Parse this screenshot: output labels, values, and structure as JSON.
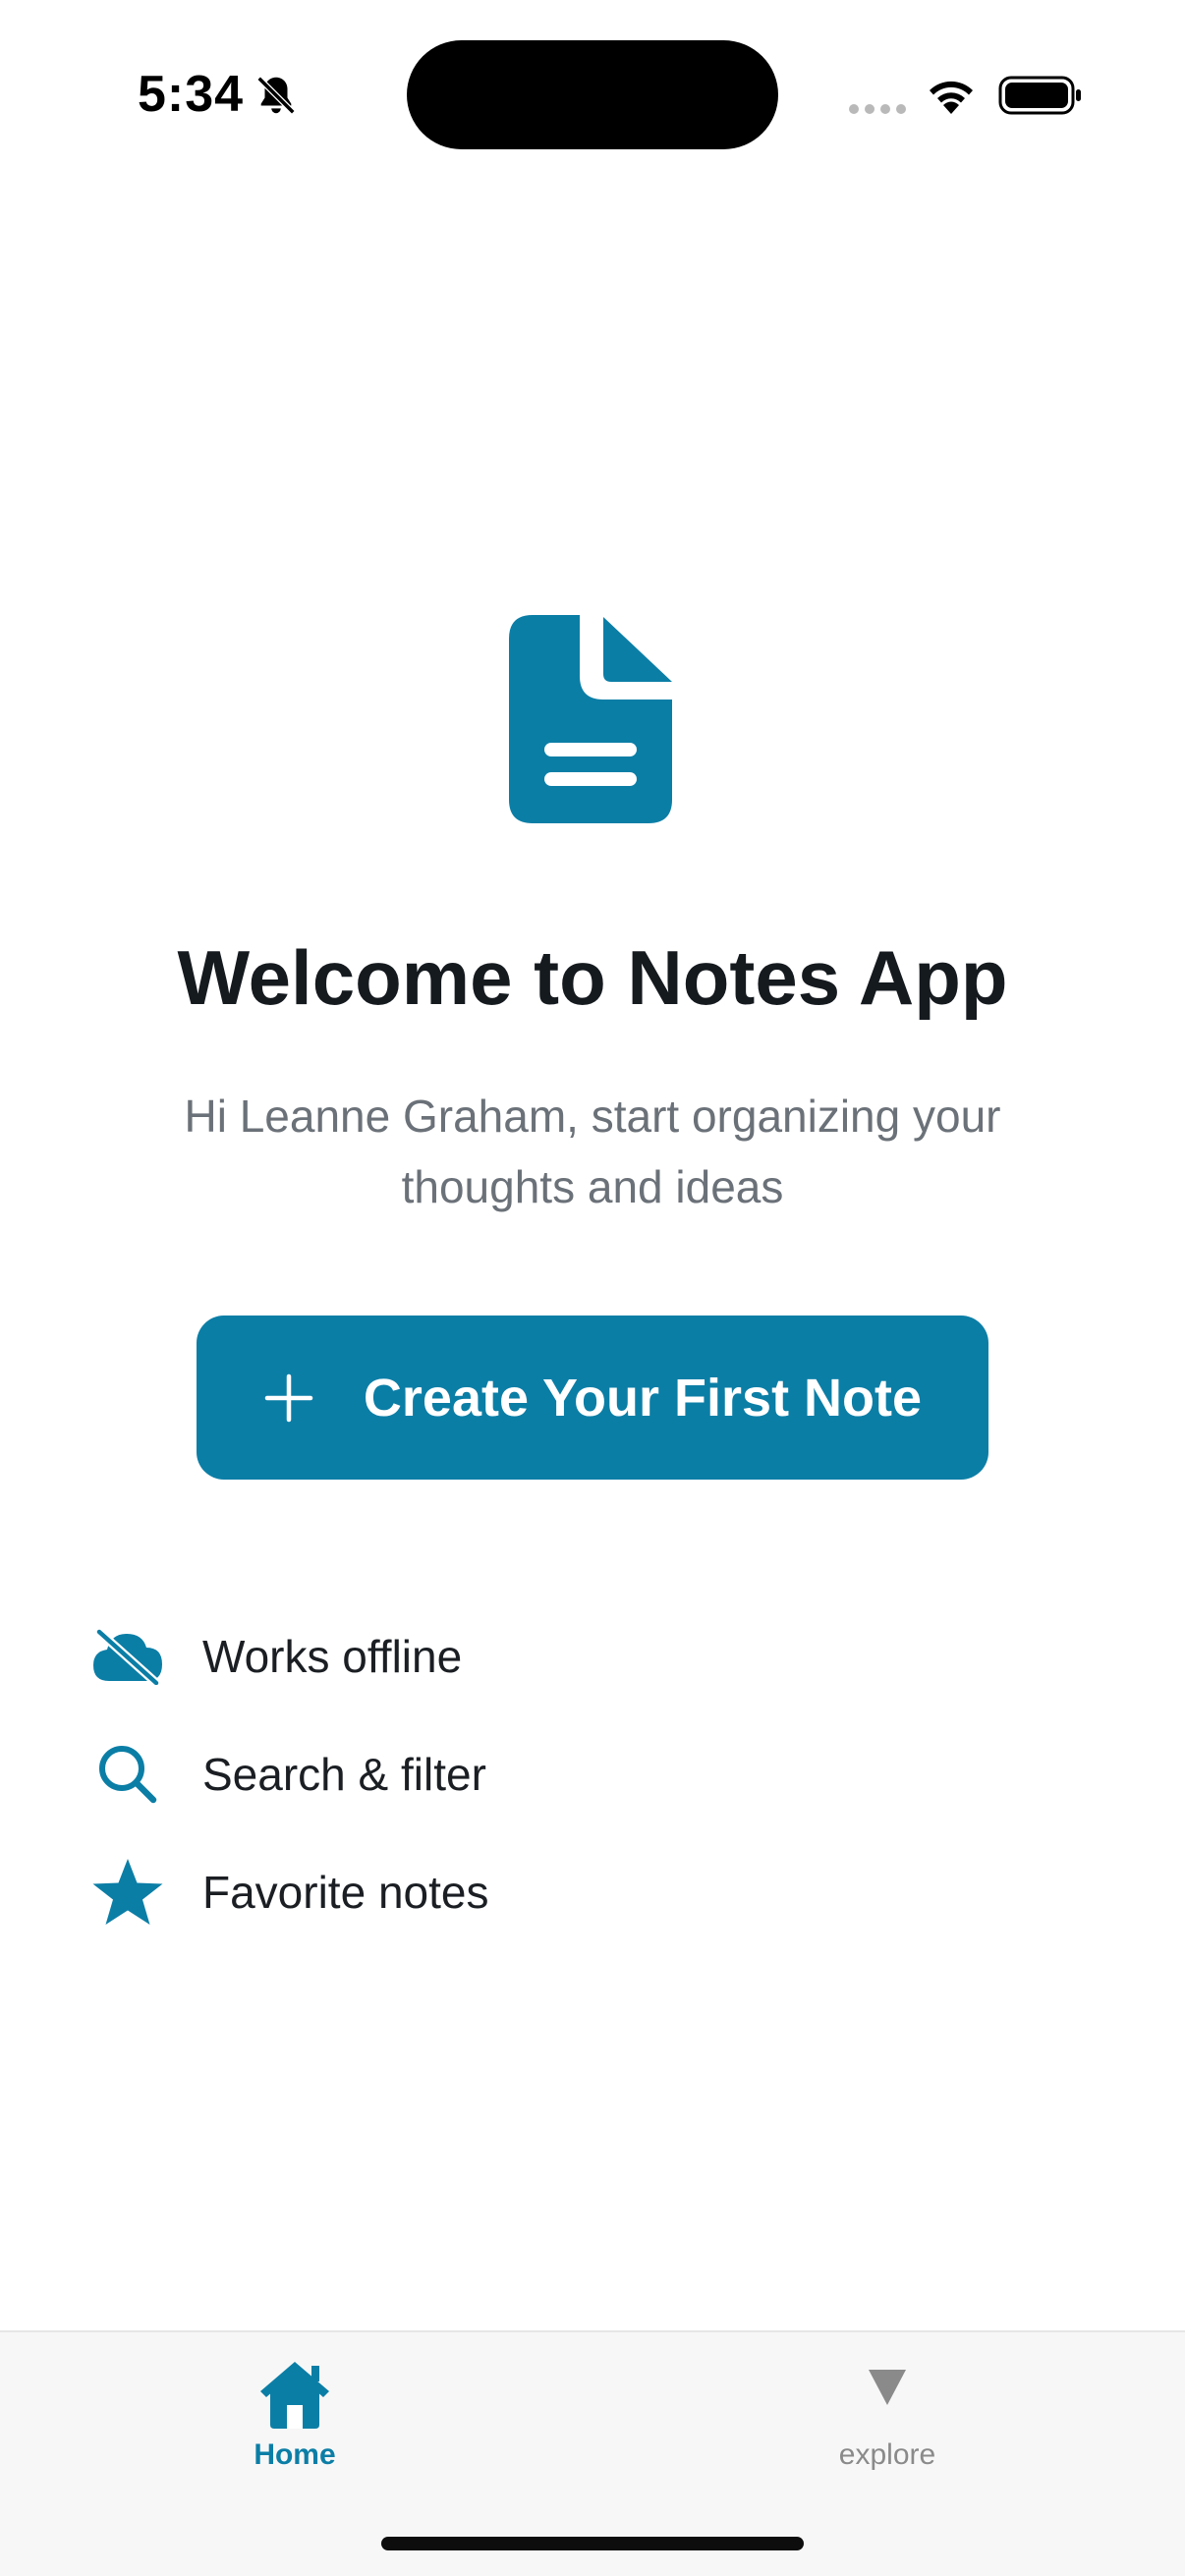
{
  "status_bar": {
    "time": "5:34",
    "icons": [
      "bell-slash-icon",
      "cellular-signal-icon",
      "wifi-icon",
      "battery-icon"
    ]
  },
  "hero": {
    "icon": "document-icon",
    "title": "Welcome to Notes App",
    "subtitle": "Hi Leanne Graham, start organizing your thoughts and ideas"
  },
  "primary_action": {
    "icon": "plus-icon",
    "label": "Create Your First Note"
  },
  "features": [
    {
      "icon": "cloud-offline-icon",
      "label": "Works offline"
    },
    {
      "icon": "search-icon",
      "label": "Search & filter"
    },
    {
      "icon": "star-icon",
      "label": "Favorite notes"
    }
  ],
  "tab_bar": {
    "tabs": [
      {
        "icon": "home-icon",
        "label": "Home",
        "active": true
      },
      {
        "icon": "triangle-down-icon",
        "label": "explore",
        "active": false
      }
    ]
  },
  "colors": {
    "accent": "#0b7ea6",
    "title": "#151a1f",
    "subtitle": "#6b7178",
    "tab_inactive": "#8a8a8a",
    "tab_bar_bg": "#f7f7f7"
  }
}
